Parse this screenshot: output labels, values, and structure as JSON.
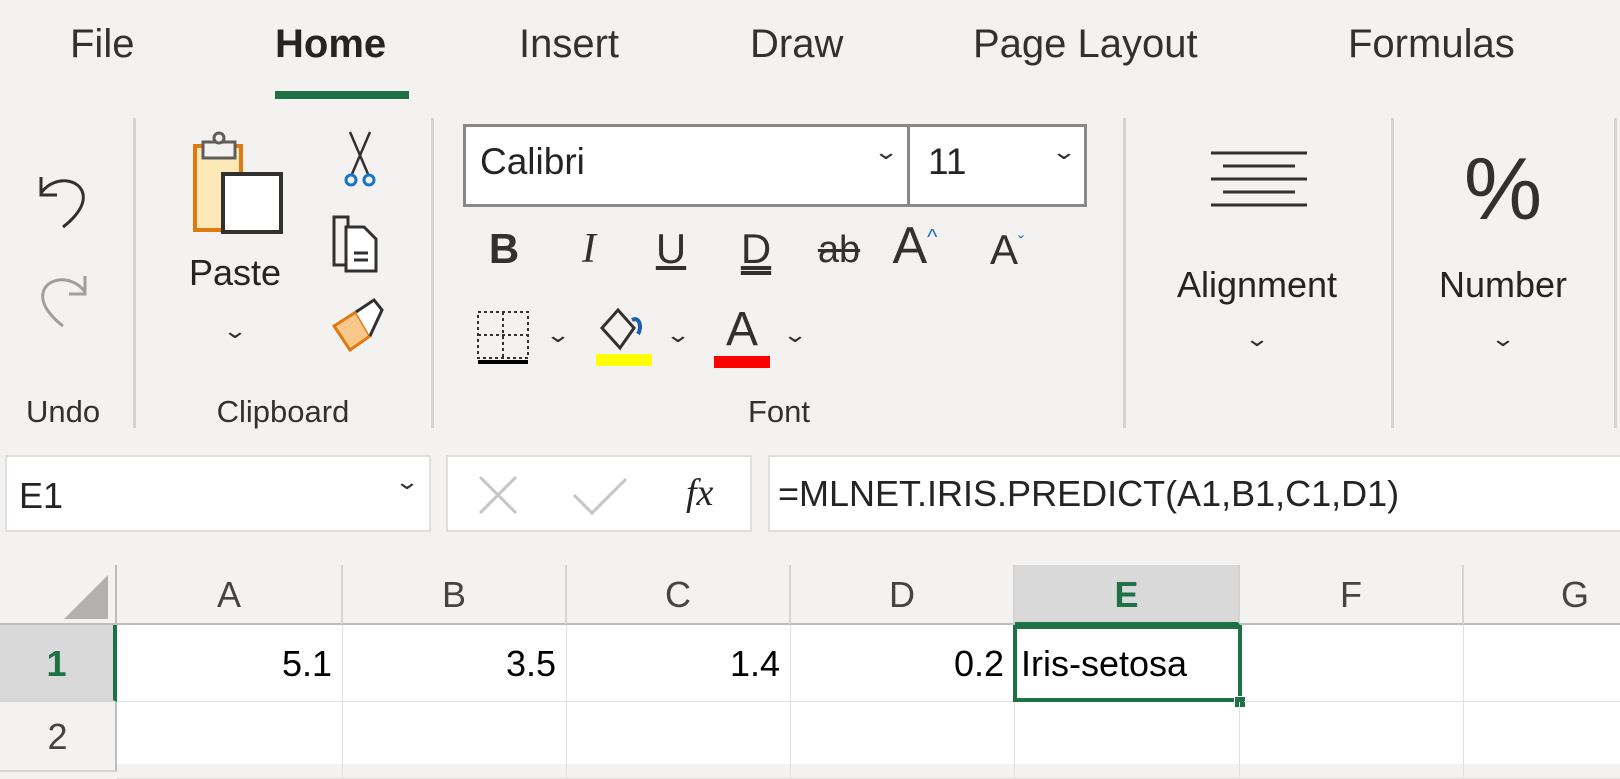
{
  "tabs": [
    "File",
    "Home",
    "Insert",
    "Draw",
    "Page Layout",
    "Formulas"
  ],
  "active_tab": "Home",
  "groups": {
    "undo": {
      "label": "Undo"
    },
    "clipboard": {
      "label": "Clipboard",
      "paste_label": "Paste"
    },
    "font": {
      "label": "Font",
      "font_name": "Calibri",
      "font_size": "11",
      "bold": "B",
      "italic": "I",
      "underline": "U",
      "double_underline": "D",
      "strikethrough": "ab",
      "grow": "A",
      "shrink": "A",
      "font_color_glyph": "A",
      "fill_color": "#ffff00",
      "font_color": "#ff0000"
    },
    "alignment": {
      "label": "Alignment"
    },
    "number": {
      "label": "Number",
      "icon_glyph": "%"
    }
  },
  "formula_bar": {
    "name_box": "E1",
    "fx": "fx",
    "formula": "=MLNET.IRIS.PREDICT(A1,B1,C1,D1)"
  },
  "sheet": {
    "columns": [
      "A",
      "B",
      "C",
      "D",
      "E",
      "F",
      "G"
    ],
    "selected_column": "E",
    "rows": [
      {
        "label": "1",
        "cells": [
          "5.1",
          "3.5",
          "1.4",
          "0.2",
          "Iris-setosa",
          "",
          ""
        ]
      },
      {
        "label": "2",
        "cells": [
          "",
          "",
          "",
          "",
          "",
          "",
          ""
        ]
      }
    ],
    "active_cell": "E1"
  },
  "accent_color": "#1e7145"
}
